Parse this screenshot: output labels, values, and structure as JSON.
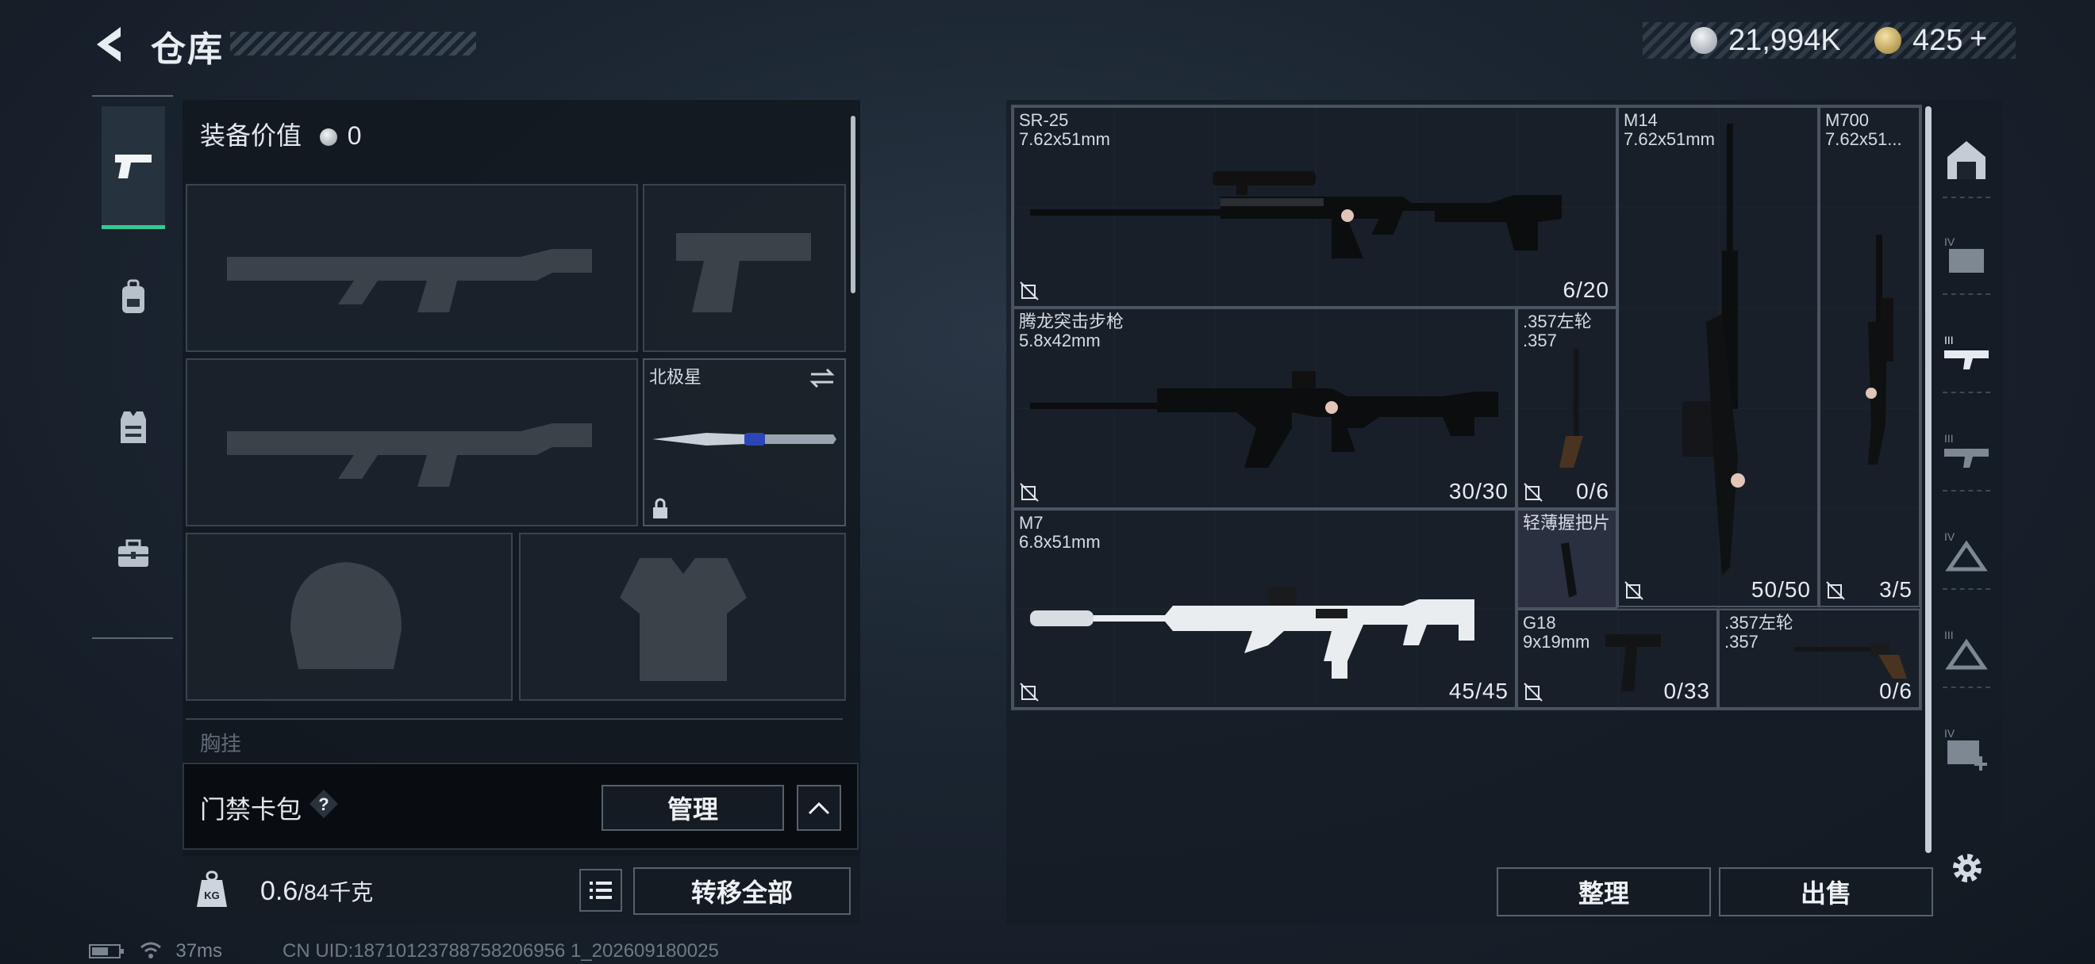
{
  "header": {
    "title": "仓库",
    "currency": [
      {
        "icon": "silver-coin-icon",
        "value": "21,994K",
        "color": "#b9c2cb"
      },
      {
        "icon": "gold-coin-icon",
        "value": "425",
        "plus": "+",
        "color": "#c9a752"
      }
    ]
  },
  "sidebar": {
    "tabs": [
      {
        "icon": "pistol-icon",
        "active": true
      },
      {
        "icon": "backpack-icon",
        "active": false
      },
      {
        "icon": "vest-icon",
        "active": false
      },
      {
        "icon": "toolbox-icon",
        "active": false
      }
    ]
  },
  "loadout": {
    "equip_value_label": "装备价值",
    "equip_value": "0",
    "melee_slot": {
      "name": "北极星"
    },
    "chest_rig_label": "胸挂",
    "card_pack_label": "门禁卡包",
    "help_glyph": "?",
    "manage_label": "管理",
    "weight": "0.6",
    "weight_capacity": "/84千克",
    "kg_label": "KG",
    "transfer_all_label": "转移全部"
  },
  "stash": {
    "items": [
      {
        "name": "SR-25",
        "caliber": "7.62x51mm",
        "qty": "6/20"
      },
      {
        "name": "M14",
        "caliber": "7.62x51mm",
        "qty": "50/50"
      },
      {
        "name": "M700",
        "caliber": "7.62x51...",
        "qty": "3/5"
      },
      {
        "name": "腾龙突击步枪",
        "caliber": "5.8x42mm",
        "qty": "30/30"
      },
      {
        "name": ".357左轮",
        "caliber": ".357",
        "qty": "0/6"
      },
      {
        "name": "M7",
        "caliber": "6.8x51mm",
        "qty": "45/45"
      },
      {
        "name": "轻薄握把片",
        "caliber": "",
        "qty": ""
      },
      {
        "name": "G18",
        "caliber": "9x19mm",
        "qty": "0/33"
      },
      {
        "name": ".357左轮",
        "caliber": ".357",
        "qty": "0/6"
      }
    ],
    "sort_label": "整理",
    "sell_label": "出售"
  },
  "filters": [
    "home-icon",
    "case-iv-icon",
    "rifle-iii-icon",
    "smg-iii-icon",
    "helmet-iv-icon",
    "helmet-iii-icon",
    "medkit-iv-icon"
  ],
  "status": {
    "ping": "37ms",
    "uid": "CN UID:18710123788758206956 1_202609180025"
  }
}
